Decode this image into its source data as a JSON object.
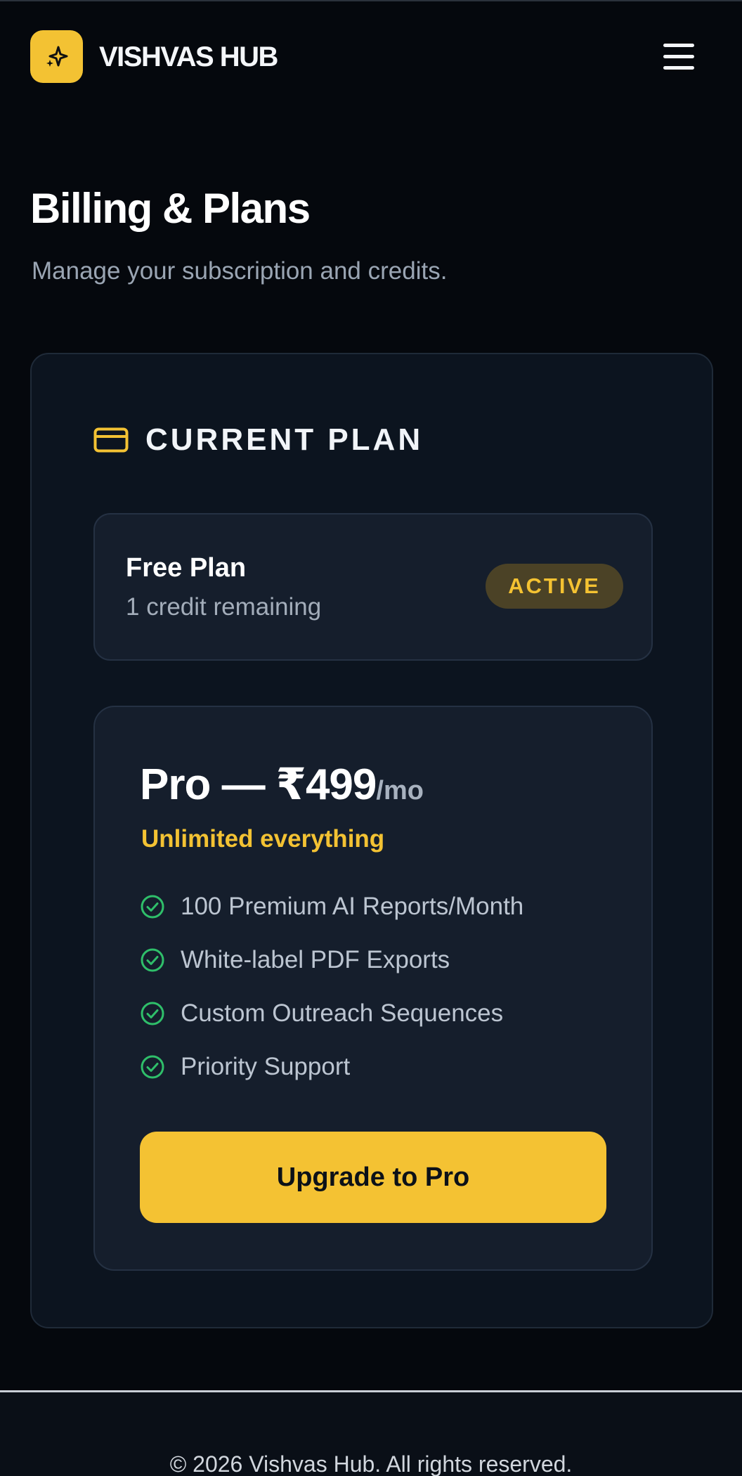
{
  "brand": {
    "name": "VISHVAS HUB",
    "logo_icon": "sparkle-icon",
    "accent_color": "#f3c233"
  },
  "header": {
    "menu_icon": "hamburger-menu-icon"
  },
  "page": {
    "title": "Billing & Plans",
    "subtitle": "Manage your subscription and credits."
  },
  "current_plan": {
    "section_icon": "credit-card-icon",
    "section_label": "CURRENT PLAN",
    "plan_name": "Free Plan",
    "credits": "1 credit remaining",
    "status_badge": "ACTIVE",
    "badge_color": "#f4c232"
  },
  "pro_plan": {
    "title": "Pro — ₹499",
    "period": "/mo",
    "tagline": "Unlimited everything",
    "feature_icon": "check-circle-icon",
    "check_color": "#2fbf6a",
    "features": [
      "100 Premium AI Reports/Month",
      "White-label PDF Exports",
      "Custom Outreach Sequences",
      "Priority Support"
    ],
    "cta_label": "Upgrade to Pro"
  },
  "footer": {
    "copyright": "© 2026 Vishvas Hub. All rights reserved."
  }
}
